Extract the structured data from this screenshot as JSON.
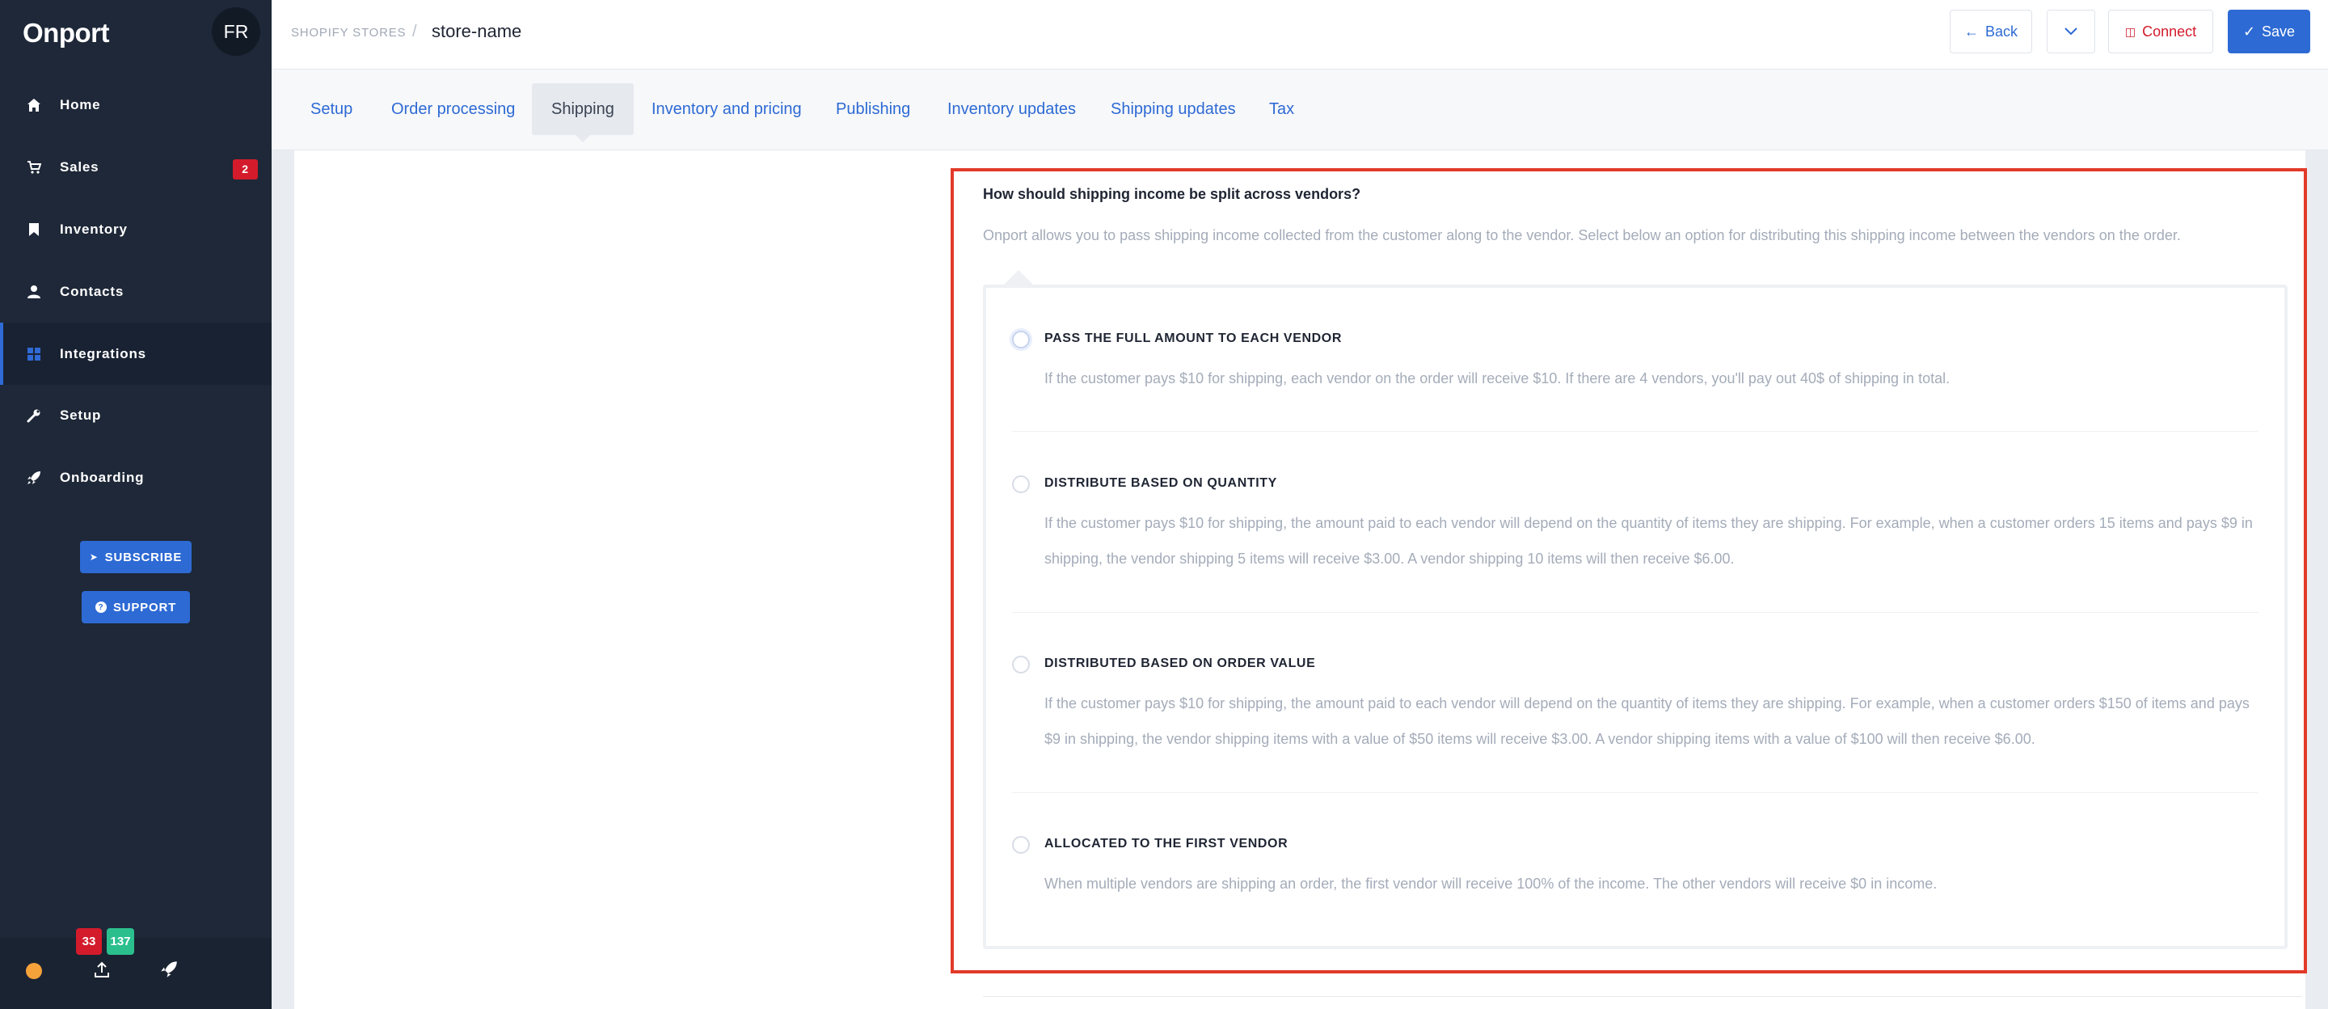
{
  "app": {
    "logo": "Onport",
    "avatar_initials": "FR"
  },
  "sidebar": {
    "items": [
      {
        "label": "Home",
        "icon": "home-icon"
      },
      {
        "label": "Sales",
        "icon": "cart-icon",
        "badge": "2"
      },
      {
        "label": "Inventory",
        "icon": "bookmark-icon"
      },
      {
        "label": "Contacts",
        "icon": "user-icon"
      },
      {
        "label": "Integrations",
        "icon": "grid-icon",
        "active": true
      },
      {
        "label": "Setup",
        "icon": "wrench-icon"
      },
      {
        "label": "Onboarding",
        "icon": "rocket-icon"
      }
    ],
    "subscribe_label": "SUBSCRIBE",
    "support_label": "SUPPORT",
    "footer": {
      "red_count": "33",
      "green_count": "137"
    }
  },
  "header": {
    "breadcrumb_parent": "SHOPIFY STORES",
    "breadcrumb_sep": "/",
    "breadcrumb_current": "store-name",
    "back_label": "Back",
    "connect_label": "Connect",
    "save_label": "Save"
  },
  "tabs": [
    {
      "label": "Setup"
    },
    {
      "label": "Order processing"
    },
    {
      "label": "Shipping",
      "active": true
    },
    {
      "label": "Inventory and pricing"
    },
    {
      "label": "Publishing"
    },
    {
      "label": "Inventory updates"
    },
    {
      "label": "Shipping updates"
    },
    {
      "label": "Tax"
    }
  ],
  "form": {
    "question": "How should shipping income be split across vendors?",
    "intro": "Onport allows you to pass shipping income collected from the customer along to the vendor. Select below an option for distributing this shipping income between the vendors on the order.",
    "options": [
      {
        "title": "PASS THE FULL AMOUNT TO EACH VENDOR",
        "desc": "If the customer pays $10 for shipping, each vendor on the order will receive $10. If there are 4 vendors, you'll pay out 40$ of shipping in total."
      },
      {
        "title": "DISTRIBUTE BASED ON QUANTITY",
        "desc": "If the customer pays $10 for shipping, the amount paid to each vendor will depend on the quantity of items they are shipping. For example, when a customer orders 15 items and pays $9 in shipping, the vendor shipping 5 items will receive $3.00. A vendor shipping 10 items will then receive $6.00."
      },
      {
        "title": "DISTRIBUTED BASED ON ORDER VALUE",
        "desc": "If the customer pays $10 for shipping, the amount paid to each vendor will depend on the quantity of items they are shipping. For example, when a customer orders $150 of items and pays $9 in shipping, the vendor shipping items with a value of $50 items will receive $3.00. A vendor shipping items with a value of $100 will then receive $6.00."
      },
      {
        "title": "ALLOCATED TO THE FIRST VENDOR",
        "desc": "When multiple vendors are shipping an order, the first vendor will receive 100% of the income. The other vendors will receive $0 in income."
      }
    ]
  },
  "colors": {
    "sidebar_bg": "#1e2838",
    "accent": "#2d6ad4",
    "danger": "#d31b2b",
    "success": "#2bbf8e",
    "highlight": "#e23a29"
  }
}
